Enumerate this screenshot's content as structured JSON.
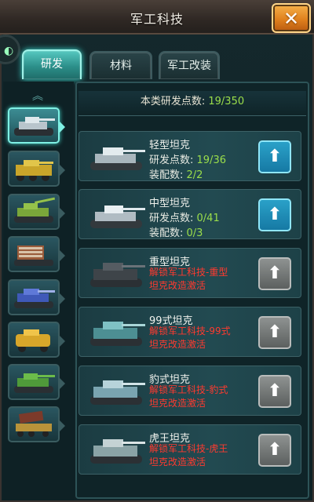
{
  "window": {
    "title": "军工科技"
  },
  "tabs": [
    {
      "label": "研发",
      "active": true
    },
    {
      "label": "材料",
      "active": false
    },
    {
      "label": "军工改装",
      "active": false
    }
  ],
  "header": {
    "label": "本类研发点数: ",
    "value": "19/350"
  },
  "units": [
    "light-tank",
    "armored-car",
    "tank-destroyer",
    "rocket-launcher",
    "heavy-tank",
    "scout-vehicle",
    "main-battle-tank",
    "missile-truck"
  ],
  "items": [
    {
      "name": "轻型坦克",
      "line1_label": "研发点数: ",
      "line1_value": "19/36",
      "line2_label": "装配数: ",
      "line2_value": "2/2",
      "locked": false
    },
    {
      "name": "中型坦克",
      "line1_label": "研发点数: ",
      "line1_value": "0/41",
      "line2_label": "装配数: ",
      "line2_value": "0/3",
      "locked": false
    },
    {
      "name": "重型坦克",
      "lock_text": "解锁军工科技-重型坦克改造激活",
      "locked": true
    },
    {
      "name": "99式坦克",
      "lock_text": "解锁军工科技-99式坦克改造激活",
      "locked": true
    },
    {
      "name": "豹式坦克",
      "lock_text": "解锁军工科技-豹式坦克改造激活",
      "locked": true
    },
    {
      "name": "虎王坦克",
      "lock_text": "解锁军工科技-虎王坦克改造激活",
      "locked": true
    }
  ],
  "colors": {
    "accent": "#56c8c0",
    "value_green": "#9bde4a",
    "lock_red": "#ff3a2f",
    "close_orange": "#e0811e"
  }
}
